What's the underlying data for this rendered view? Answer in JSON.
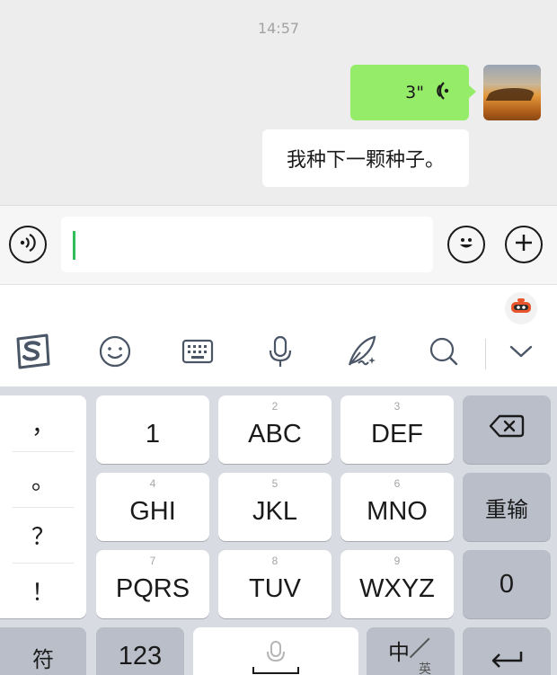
{
  "chat": {
    "timestamp": "14:57",
    "voice_message": {
      "duration": "3\""
    },
    "text_message": "我种下一颗种子。"
  },
  "input_bar": {
    "text_value": ""
  },
  "keyboard": {
    "punctuation": [
      "，",
      "。",
      "？",
      "！"
    ],
    "keys": {
      "k1": {
        "main": "1",
        "sub": ""
      },
      "k2": {
        "main": "ABC",
        "sub": "2"
      },
      "k3": {
        "main": "DEF",
        "sub": "3"
      },
      "k4": {
        "main": "GHI",
        "sub": "4"
      },
      "k5": {
        "main": "JKL",
        "sub": "5"
      },
      "k6": {
        "main": "MNO",
        "sub": "6"
      },
      "k7": {
        "main": "PQRS",
        "sub": "7"
      },
      "k8": {
        "main": "TUV",
        "sub": "8"
      },
      "k9": {
        "main": "WXYZ",
        "sub": "9"
      }
    },
    "reinput": "重输",
    "zero": "0",
    "symbols": "符",
    "num_toggle": "123",
    "lang_main": "中",
    "lang_sub": "英"
  },
  "colors": {
    "accent": "#2fbe5a",
    "bubble_green": "#95ec69",
    "key_dark": "#b9bec8"
  }
}
